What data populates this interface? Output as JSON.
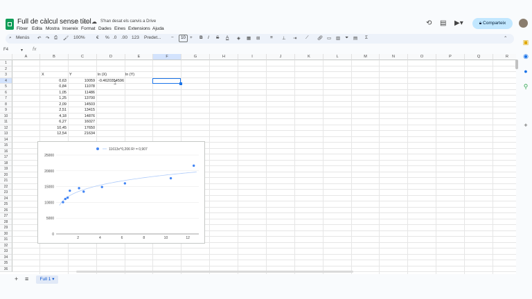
{
  "app": {
    "doc_title": "Full de càlcul sense títol",
    "save_status": "S'han desat els canvis a Drive",
    "share_label": "Comparteix"
  },
  "menu": [
    "Fitxer",
    "Edita",
    "Mostra",
    "Insereix",
    "Format",
    "Dades",
    "Eines",
    "Extensions",
    "Ajuda"
  ],
  "toolbar": {
    "search_label": "Menús",
    "zoom": "100%",
    "currency": "€",
    "percent": "%",
    "dec_less": ".0",
    "dec_more": ".00",
    "num_format": "123",
    "font_name": "Predet...",
    "font_size": "10",
    "bold": "B",
    "italic": "I",
    "strike": "S",
    "text_color": "A",
    "sum": "Σ"
  },
  "formula_bar": {
    "name_box": "F4",
    "fx": "fx",
    "formula": ""
  },
  "columns": [
    "A",
    "B",
    "C",
    "D",
    "E",
    "F",
    "G",
    "H",
    "I",
    "J",
    "K",
    "L",
    "M",
    "N",
    "O",
    "P",
    "Q",
    "R"
  ],
  "rows": [
    "1",
    "2",
    "3",
    "4",
    "5",
    "6",
    "7",
    "8",
    "9",
    "10",
    "11",
    "12",
    "13",
    "14",
    "15",
    "16",
    "17",
    "18",
    "19",
    "20",
    "21",
    "22",
    "23",
    "24",
    "25",
    "26",
    "27",
    "28",
    "29",
    "30",
    "31",
    "32",
    "33",
    "34",
    "35",
    "36"
  ],
  "sheet": {
    "headers": {
      "b3": "X",
      "c3": "Y",
      "d3": "ln (X)",
      "e3": "ln (Y)"
    },
    "d4": "-0.4620354596",
    "data": [
      {
        "x": "0,63",
        "y": "10059"
      },
      {
        "x": "0,84",
        "y": "11078"
      },
      {
        "x": "1,05",
        "y": "11486"
      },
      {
        "x": "1,25",
        "y": "13700"
      },
      {
        "x": "2,09",
        "y": "14503"
      },
      {
        "x": "2,51",
        "y": "13415"
      },
      {
        "x": "4,18",
        "y": "14876"
      },
      {
        "x": "6,27",
        "y": "16027"
      },
      {
        "x": "10,45",
        "y": "17650"
      },
      {
        "x": "12,54",
        "y": "21634"
      }
    ]
  },
  "sheet_tab": "Full 1",
  "colors": {
    "accent": "#1a73e8",
    "series": "#4285f4",
    "trend": "#aecbfa",
    "share_bg": "#c2e7ff"
  },
  "chart_data": {
    "type": "scatter",
    "legend": "11613x^0,206 R² = 0,907",
    "x": [
      0.63,
      0.84,
      1.05,
      1.25,
      2.09,
      2.51,
      4.18,
      6.27,
      10.45,
      12.54
    ],
    "y": [
      10059,
      11078,
      11486,
      13700,
      14503,
      13415,
      14876,
      16027,
      17650,
      21634
    ],
    "trendline": {
      "a": 11613,
      "b": 0.206
    },
    "xlim": [
      0,
      13
    ],
    "ylim": [
      0,
      25000
    ],
    "xticks": [
      "2",
      "4",
      "6",
      "8",
      "10",
      "12"
    ],
    "yticks": [
      "0",
      "5000",
      "10000",
      "15000",
      "20000",
      "25000"
    ],
    "grid": true,
    "legend_position": "top"
  }
}
